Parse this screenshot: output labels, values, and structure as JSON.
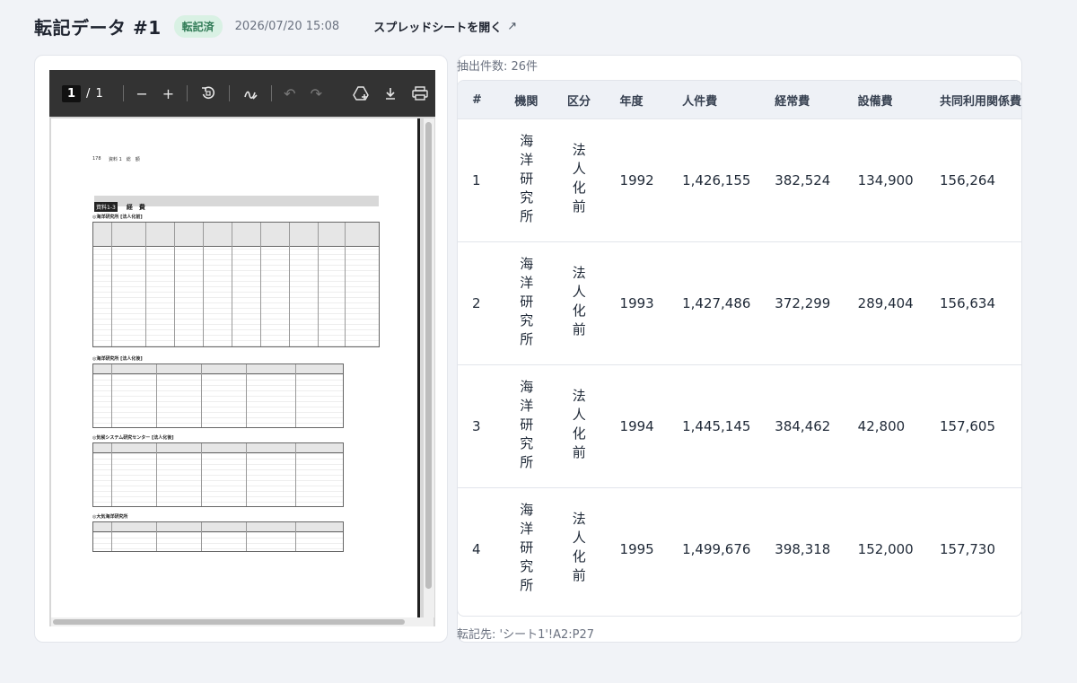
{
  "header": {
    "title": "転記データ #1",
    "status_badge": "転記済",
    "timestamp": "2026/07/20 15:08",
    "open_sheet_label": "スプレッドシートを開く"
  },
  "pdf_viewer": {
    "page_current": "1",
    "page_total": "1",
    "document": {
      "page_number": "178",
      "header_text": "資料 1　総　額",
      "section_tag": "資料1-3",
      "section_label": "経　費",
      "subsections": [
        "◎海洋研究所 [法人化前]",
        "◎海洋研究所 [法人化後]",
        "◎気候システム研究センター [法人化後]",
        "◎大気海洋研究所"
      ]
    }
  },
  "results": {
    "count_label": "抽出件数: 26件",
    "columns": [
      "#",
      "機関",
      "区分",
      "年度",
      "人件費",
      "経常費",
      "設備費",
      "共同利用関係費"
    ],
    "rows": [
      {
        "num": "1",
        "org": "海洋研究所",
        "division": "法人化前",
        "year": "1992",
        "personnel": "1,426,155",
        "ordinary": "382,524",
        "equipment": "134,900",
        "shared": "156,264"
      },
      {
        "num": "2",
        "org": "海洋研究所",
        "division": "法人化前",
        "year": "1993",
        "personnel": "1,427,486",
        "ordinary": "372,299",
        "equipment": "289,404",
        "shared": "156,634"
      },
      {
        "num": "3",
        "org": "海洋研究所",
        "division": "法人化前",
        "year": "1994",
        "personnel": "1,445,145",
        "ordinary": "384,462",
        "equipment": "42,800",
        "shared": "157,605"
      },
      {
        "num": "4",
        "org": "海洋研究所",
        "division": "法人化前",
        "year": "1995",
        "personnel": "1,499,676",
        "ordinary": "398,318",
        "equipment": "152,000",
        "shared": "157,730"
      }
    ],
    "destination_label": "転記先: 'シート1'!A2:P27"
  }
}
